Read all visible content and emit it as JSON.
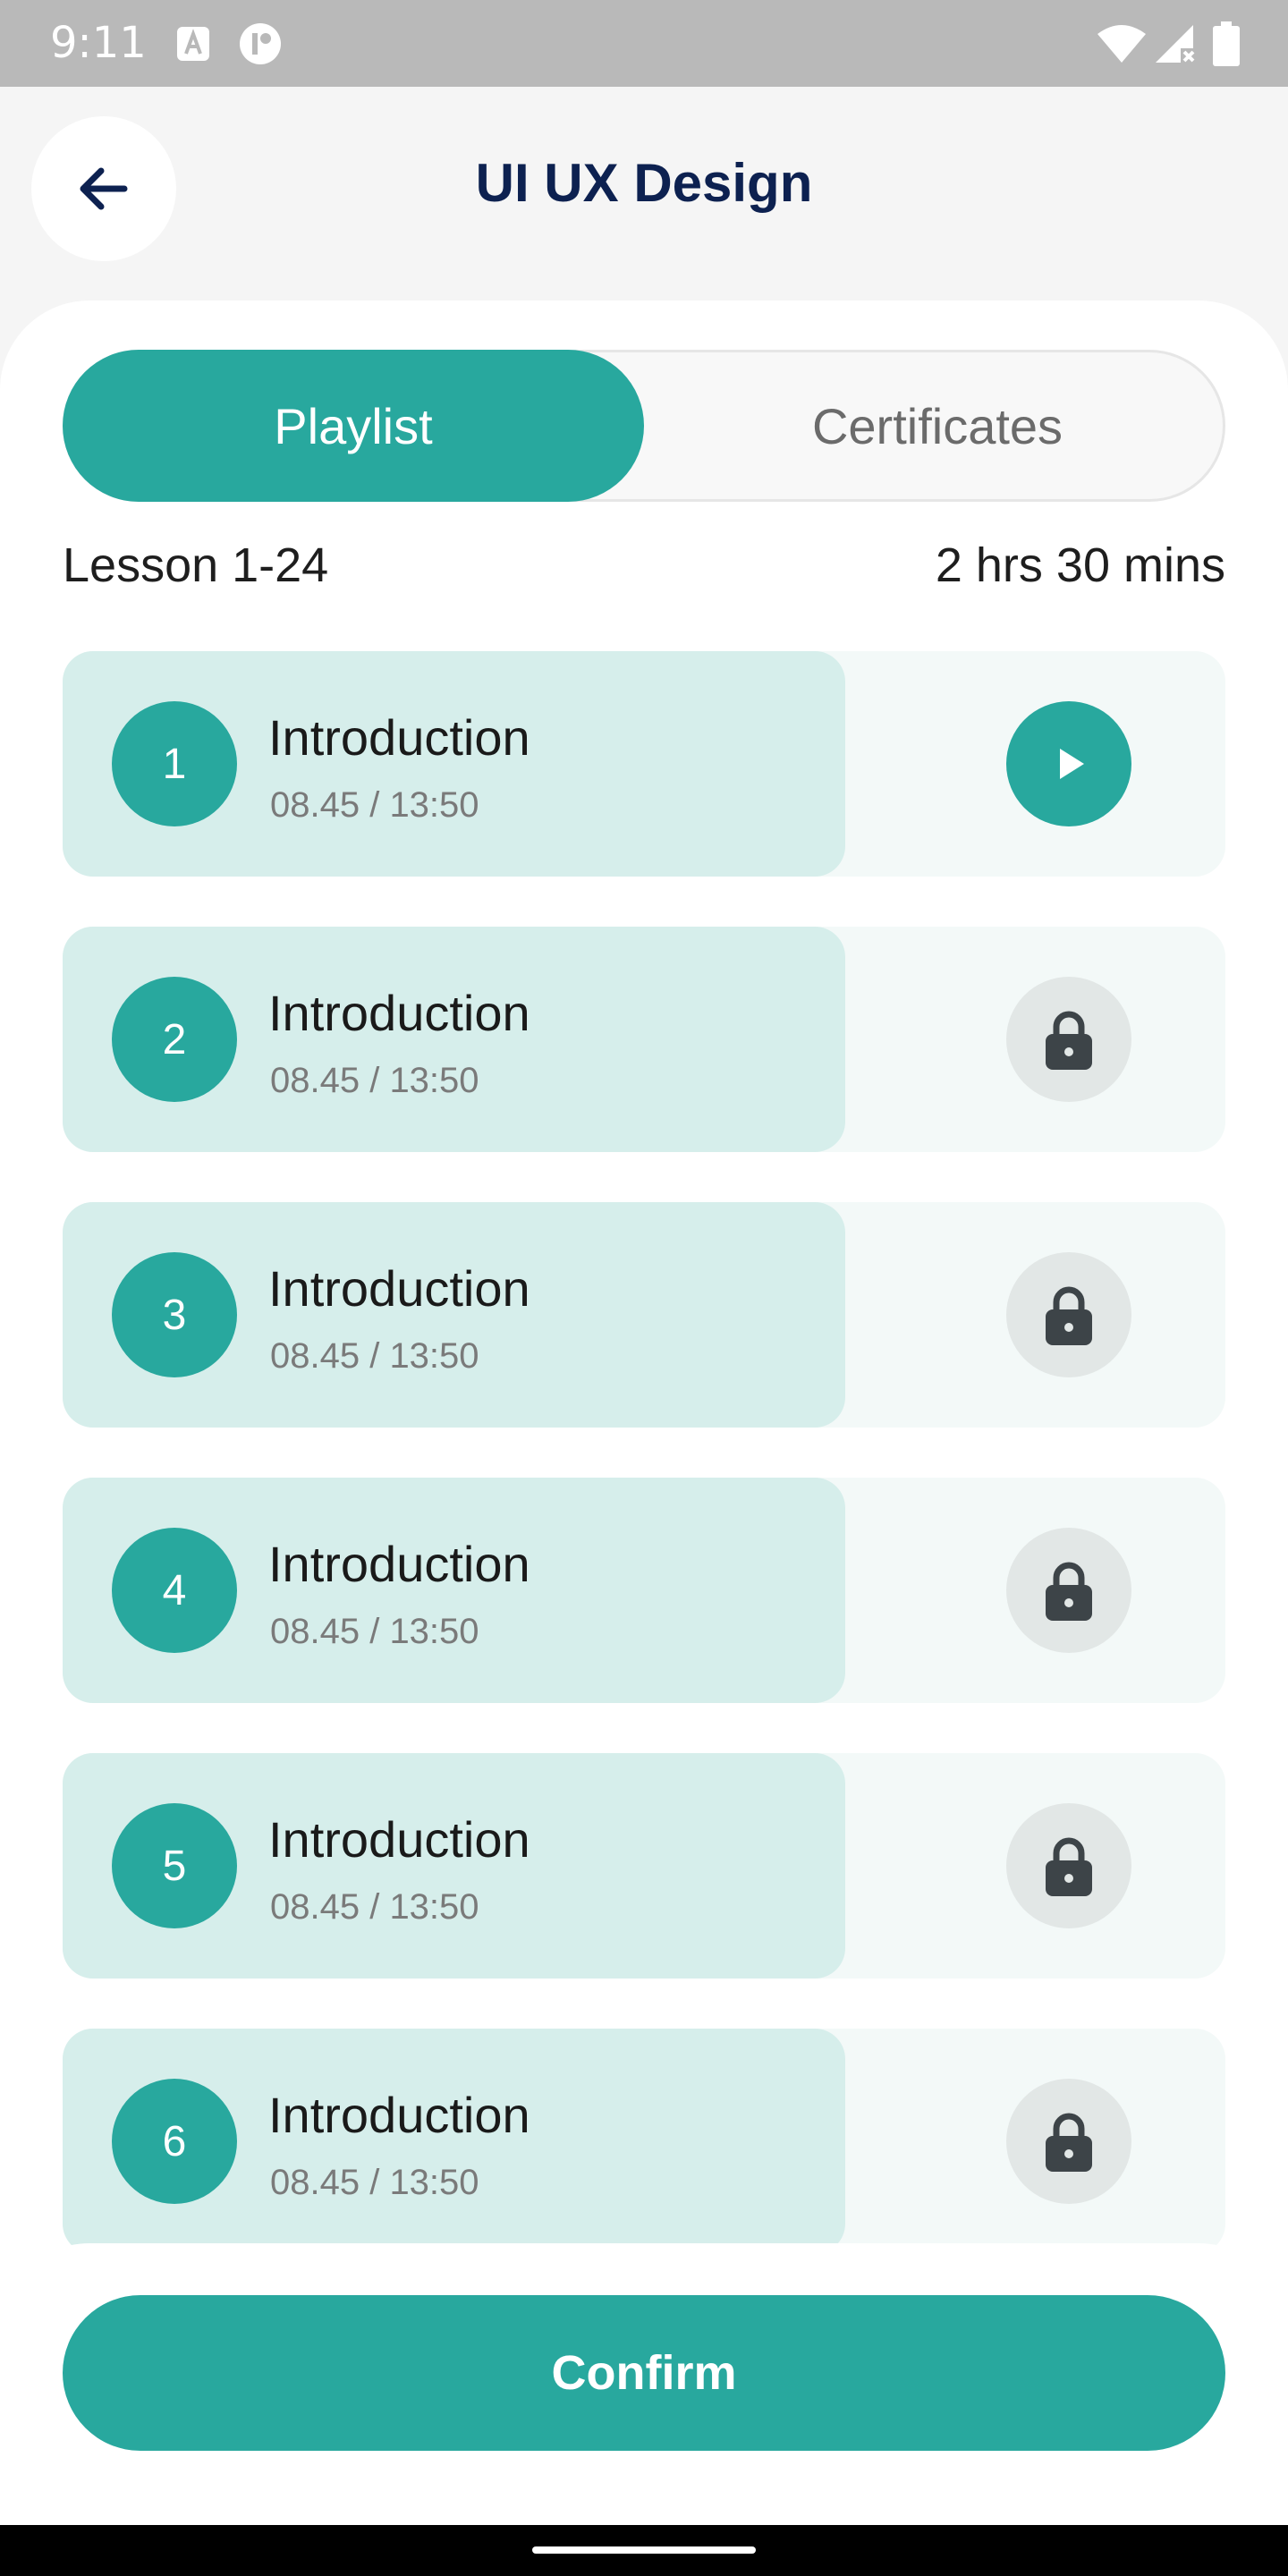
{
  "status_bar": {
    "time": "9:11"
  },
  "header": {
    "title": "UI UX Design",
    "back_icon": "arrow-left-icon"
  },
  "tabs": {
    "active": "Playlist",
    "inactive": "Certificates"
  },
  "summary": {
    "lessons": "Lesson 1-24",
    "duration": "2 hrs 30 mins"
  },
  "lessons": [
    {
      "number": "1",
      "title": "Introduction",
      "time": "08.45 / 13:50",
      "action_icon": "play-icon"
    },
    {
      "number": "2",
      "title": "Introduction",
      "time": "08.45 / 13:50",
      "action_icon": "lock-icon"
    },
    {
      "number": "3",
      "title": "Introduction",
      "time": "08.45 / 13:50",
      "action_icon": "lock-icon"
    },
    {
      "number": "4",
      "title": "Introduction",
      "time": "08.45 / 13:50",
      "action_icon": "lock-icon"
    },
    {
      "number": "5",
      "title": "Introduction",
      "time": "08.45 / 13:50",
      "action_icon": "lock-icon"
    },
    {
      "number": "6",
      "title": "Introduction",
      "time": "08.45 / 13:50",
      "action_icon": "lock-icon"
    }
  ],
  "footer": {
    "confirm_label": "Confirm"
  },
  "colors": {
    "accent": "#28a89e",
    "title": "#0d2150",
    "lesson_bg": "#d6eeeb",
    "lock_bg": "#e2e7e6"
  }
}
